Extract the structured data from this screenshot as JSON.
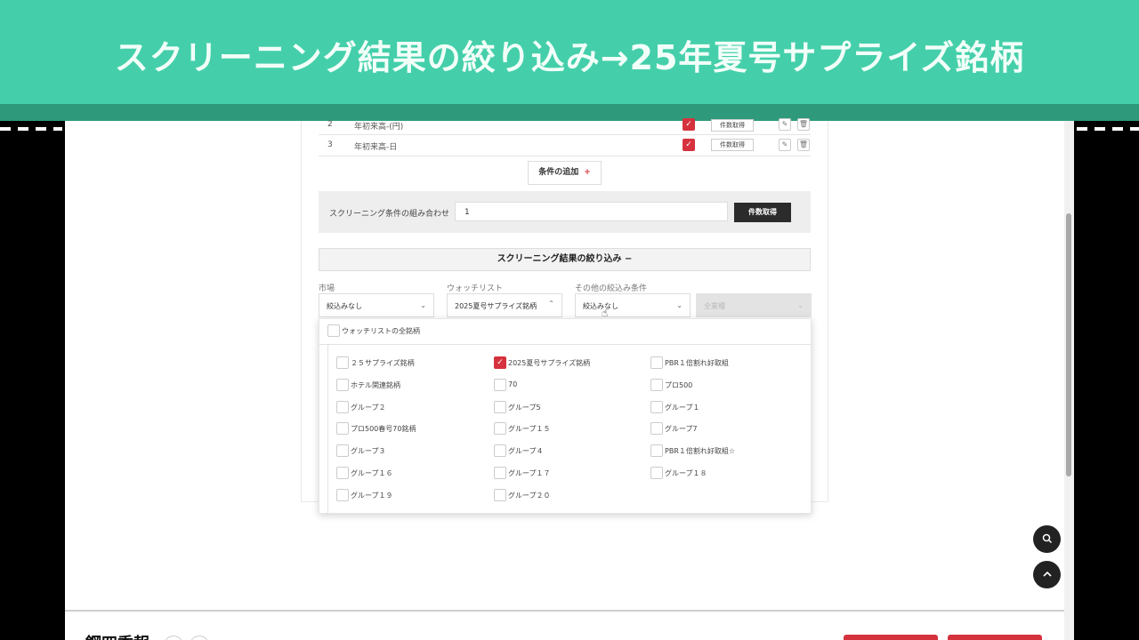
{
  "banner": {
    "title": "スクリーニング結果の絞り込み→25年夏号サプライズ銘柄"
  },
  "conditions": [
    {
      "num": "2",
      "name": "年初来高-(円)",
      "btn": "件数取得"
    },
    {
      "num": "3",
      "name": "年初来高-日",
      "btn": "件数取得"
    }
  ],
  "add_condition": {
    "label": "条件の追加",
    "plus": "+"
  },
  "combination": {
    "label": "スクリーニング条件の組み合わせ",
    "value": "1",
    "button": "件数取得"
  },
  "filter": {
    "header": "スクリーニング結果の絞り込み −",
    "market": {
      "label": "市場",
      "value": "絞込みなし"
    },
    "watchlist": {
      "label": "ウォッチリスト",
      "value": "2025夏号サプライズ銘柄"
    },
    "other": {
      "label": "その他の絞込み条件",
      "value": "絞込みなし"
    },
    "fourth": {
      "value": "全業種"
    }
  },
  "watchlist_dropdown": {
    "all_label": "ウォッチリストの全銘柄",
    "col1": [
      "２５サプライズ銘柄",
      "ホテル関連銘柄",
      "グループ２",
      "プロ500春号70銘柄",
      "グループ３",
      "グループ１６",
      "グループ１９"
    ],
    "col2": [
      "2025夏号サプライズ銘柄",
      "70",
      "グループ5",
      "グループ１５",
      "グループ４",
      "グループ１７",
      "グループ２０"
    ],
    "col3": [
      "PBR１倍割れ好取組",
      "プロ500",
      "グループ１",
      "グループ7",
      "PBR１倍割れ好取組☆",
      "グループ１８"
    ],
    "checked": "2025夏号サプライズ銘柄"
  },
  "colors": {
    "banner": "#44cfaa",
    "banner_strip": "#2e9a7b",
    "accent_red": "#d6323e",
    "dark_button": "#2b2b2b"
  },
  "icons": {
    "search": "search-icon",
    "up": "arrow-up-icon",
    "edit": "pencil-icon",
    "delete": "trash-icon"
  }
}
